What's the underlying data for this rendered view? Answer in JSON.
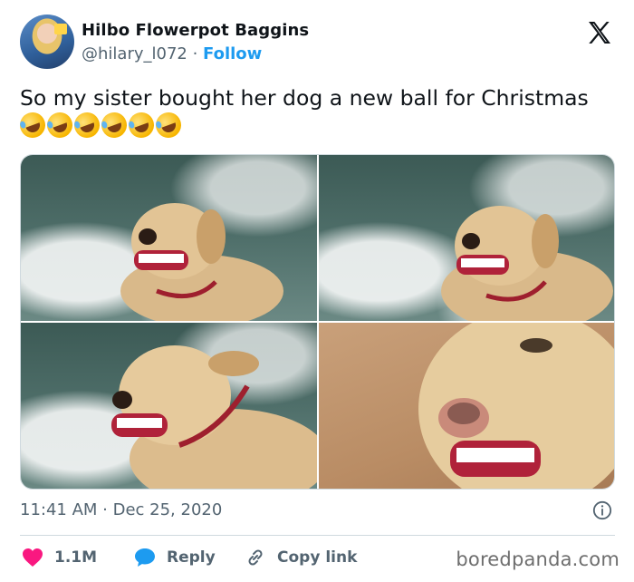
{
  "author": {
    "name": "Hilbo Flowerpot Baggins",
    "handle": "@hilary_l072",
    "separator": " · ",
    "follow_label": "Follow"
  },
  "tweet": {
    "text": "So my sister bought her dog a new ball for Christmas",
    "emoji_count": 6,
    "timestamp": "11:41 AM · Dec 25, 2020"
  },
  "media": [
    {
      "alt": "dog in waves with teeth ball",
      "scene": "water"
    },
    {
      "alt": "dog in surf with teeth ball",
      "scene": "water"
    },
    {
      "alt": "dog looking sideways with teeth ball",
      "scene": "water"
    },
    {
      "alt": "dog close-up with teeth ball",
      "scene": "sand"
    }
  ],
  "actions": {
    "likes": "1.1M",
    "reply_label": "Reply",
    "copy_link_label": "Copy link"
  },
  "watermark": "boredpanda.com",
  "colors": {
    "accent": "#1d9bf0",
    "like": "#f91880",
    "muted": "#536471",
    "text": "#0f1419"
  },
  "icons": [
    "x-logo-icon",
    "info-icon",
    "heart-icon",
    "reply-bubble-icon",
    "link-icon",
    "rofl-emoji-icon"
  ]
}
